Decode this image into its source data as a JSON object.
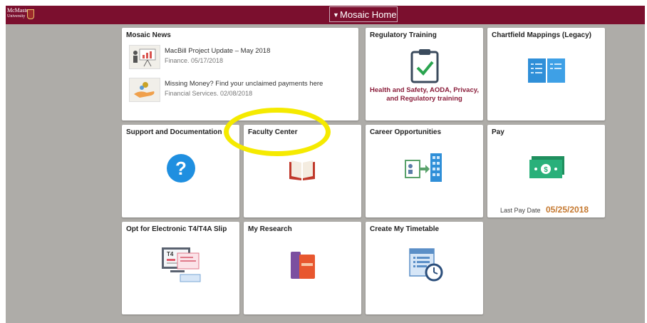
{
  "header": {
    "logo_text_line1": "McMaster",
    "logo_text_line2": "University",
    "home_label": "Mosaic Home",
    "home_caret": "▼"
  },
  "tiles": {
    "news": {
      "title": "Mosaic News",
      "items": [
        {
          "title": "MacBill Project Update – May 2018",
          "meta": "Finance. 05/17/2018"
        },
        {
          "title": "Missing Money? Find your unclaimed payments here",
          "meta": "Financial Services. 02/08/2018"
        }
      ]
    },
    "regulatory": {
      "title": "Regulatory Training",
      "text_line1": "Health and Safety, AODA, Privacy,",
      "text_line2": "and Regulatory training"
    },
    "chartfield": {
      "title": "Chartfield Mappings (Legacy)"
    },
    "support": {
      "title": "Support and Documentation"
    },
    "faculty": {
      "title": "Faculty Center"
    },
    "career": {
      "title": "Career Opportunities"
    },
    "pay": {
      "title": "Pay",
      "last_pay_label": "Last Pay Date",
      "last_pay_date": "05/25/2018"
    },
    "t4": {
      "title": "Opt for Electronic T4/T4A Slip",
      "icon_text": "T4"
    },
    "research": {
      "title": "My Research"
    },
    "timetable": {
      "title": "Create My Timetable"
    }
  },
  "colors": {
    "header_bg": "#7b0f2e",
    "page_bg": "#aeaca8",
    "accent_maroon": "#8a1d3a",
    "pay_date": "#c5782f",
    "highlight": "#f5ea00"
  },
  "icons": {
    "news_1": "presentation-chart-icon",
    "news_2": "hand-coins-icon",
    "regulatory": "clipboard-check-icon",
    "chartfield": "open-book-icon",
    "support": "question-circle-icon",
    "faculty": "open-book-icon",
    "career": "person-building-icon",
    "pay": "money-bill-icon",
    "t4": "computer-slip-icon",
    "research": "books-icon",
    "timetable": "timetable-clock-icon"
  }
}
